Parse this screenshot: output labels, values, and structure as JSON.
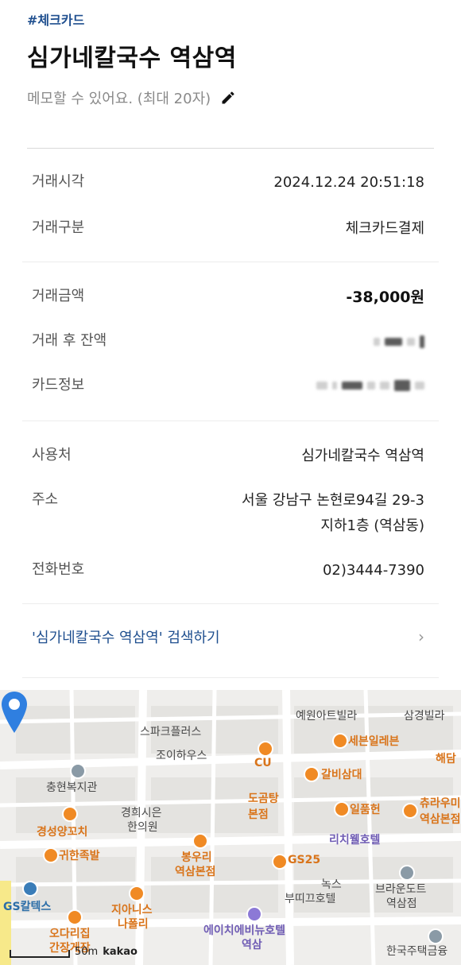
{
  "header": {
    "tag": "#체크카드",
    "title": "심가네칼국수 역삼역",
    "memo_placeholder": "메모할 수 있어요. (최대 20자)"
  },
  "section1": {
    "rows": [
      {
        "label": "거래시각",
        "value": "2024.12.24 20:51:18"
      },
      {
        "label": "거래구분",
        "value": "체크카드결제"
      }
    ]
  },
  "section2": {
    "rows": [
      {
        "label": "거래금액",
        "value": "-38,000원"
      },
      {
        "label": "거래 후 잔액",
        "value": ""
      },
      {
        "label": "카드정보",
        "value": ""
      }
    ]
  },
  "section3": {
    "rows": [
      {
        "label": "사용처",
        "value": "심가네칼국수 역삼역"
      },
      {
        "label": "주소",
        "value_line1": "서울 강남구 논현로94길 29-3",
        "value_line2": "지하1층 (역삼동)"
      },
      {
        "label": "전화번호",
        "value": "02)3444-7390"
      }
    ]
  },
  "search_link": {
    "label": "'심가네칼국수 역삼역' 검색하기"
  },
  "map": {
    "pois": [
      {
        "name": "예원아트빌라",
        "color": "gray"
      },
      {
        "name": "삼경빌라",
        "color": "gray"
      },
      {
        "name": "스파크플러스",
        "color": "gray"
      },
      {
        "name": "조이하우스",
        "color": "gray"
      },
      {
        "name": "CU",
        "color": "orange"
      },
      {
        "name": "세븐일레븐",
        "color": "orange"
      },
      {
        "name": "해담",
        "color": "orange"
      },
      {
        "name": "충현복지관",
        "color": "gray"
      },
      {
        "name": "갈비삼대",
        "color": "orange"
      },
      {
        "name": "도곰탕",
        "color": "orange"
      },
      {
        "name": "본점",
        "color": "orange"
      },
      {
        "name": "경희시은",
        "color": "gray"
      },
      {
        "name": "한의원",
        "color": "gray"
      },
      {
        "name": "일품헌",
        "color": "orange"
      },
      {
        "name": "츄라우미",
        "color": "orange"
      },
      {
        "name": "역삼본점",
        "color": "orange"
      },
      {
        "name": "경성양꼬치",
        "color": "orange"
      },
      {
        "name": "리치웰호텔",
        "color": "purple"
      },
      {
        "name": "귀한족발",
        "color": "orange"
      },
      {
        "name": "봉우리",
        "color": "orange"
      },
      {
        "name": "역삼본점",
        "color": "orange"
      },
      {
        "name": "GS25",
        "color": "orange"
      },
      {
        "name": "녹스",
        "color": "gray"
      },
      {
        "name": "부띠끄호텔",
        "color": "gray"
      },
      {
        "name": "브라운도트",
        "color": "gray"
      },
      {
        "name": "역삼점",
        "color": "gray"
      },
      {
        "name": "GS칼텍스",
        "color": "blue"
      },
      {
        "name": "지아니스",
        "color": "orange"
      },
      {
        "name": "나폴리",
        "color": "orange"
      },
      {
        "name": "에이치에비뉴호텔",
        "color": "purple"
      },
      {
        "name": "역삼",
        "color": "purple"
      },
      {
        "name": "오다리집",
        "color": "orange"
      },
      {
        "name": "간장게장",
        "color": "orange"
      },
      {
        "name": "한국주택금융",
        "color": "gray"
      }
    ],
    "scale_label": "50m",
    "brand": "kakao"
  },
  "colors": {
    "accent": "#1f4f8f",
    "map_orange": "#d9741a",
    "map_purple": "#6f5cb4",
    "pin": "#2f7fe0"
  }
}
